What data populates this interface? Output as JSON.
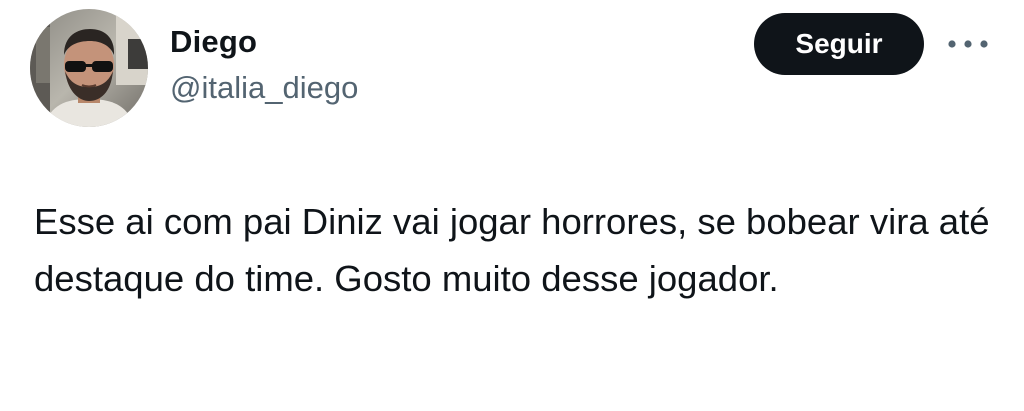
{
  "user": {
    "display_name": "Diego",
    "handle": "@italia_diego"
  },
  "actions": {
    "follow_label": "Seguir",
    "more_icon": "more-horizontal-icon"
  },
  "tweet": {
    "text": "Esse ai com pai Diniz vai jogar horrores, se bobear vira até destaque do time. Gosto muito desse jogador."
  },
  "colors": {
    "text_primary": "#0f1419",
    "text_secondary": "#536471",
    "follow_button_bg": "#0f1419",
    "follow_button_text": "#ffffff"
  }
}
